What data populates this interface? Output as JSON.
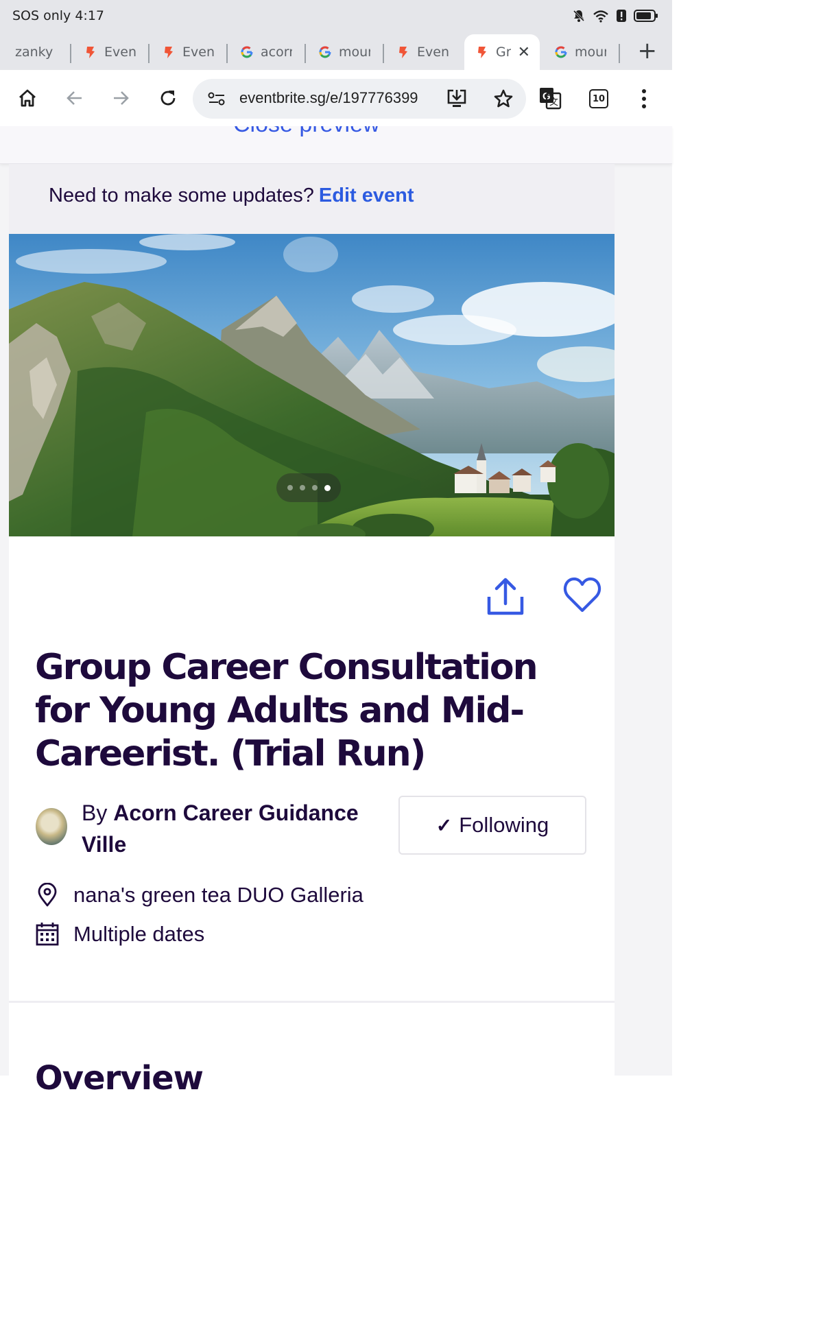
{
  "status_bar": {
    "text": "SOS only 4:17",
    "icons": [
      "bell-off-icon",
      "wifi-icon",
      "alert-icon",
      "battery-icon"
    ]
  },
  "tabs": [
    {
      "label": "zanky",
      "favicon": "generic-icon",
      "active": false
    },
    {
      "label": "Event",
      "favicon": "eventbrite-icon",
      "active": false
    },
    {
      "label": "Event",
      "favicon": "eventbrite-icon",
      "active": false
    },
    {
      "label": "acorn",
      "favicon": "google-icon",
      "active": false
    },
    {
      "label": "moun",
      "favicon": "google-icon",
      "active": false
    },
    {
      "label": "Event",
      "favicon": "eventbrite-icon",
      "active": false
    },
    {
      "label": "Gro",
      "favicon": "eventbrite-icon",
      "active": true
    },
    {
      "label": "moun",
      "favicon": "google-icon",
      "active": false
    }
  ],
  "new_tab_label": "+",
  "toolbar": {
    "url": "eventbrite.sg/e/197776399",
    "tab_count": "10"
  },
  "preview": {
    "close_label": "Close preview"
  },
  "banner": {
    "text": "Need to make some updates?",
    "link": "Edit event"
  },
  "hero": {
    "image": "mountain-village-landscape",
    "slides": 4,
    "active_slide": 4
  },
  "event": {
    "title": "Group Career Consultation for Young Adults and Mid-Careerist. (Trial Run)",
    "by_prefix": "By",
    "organizer": "Acorn Career Guidance Ville",
    "follow_label": "Following",
    "location": "nana's green tea DUO Galleria",
    "dates": "Multiple dates",
    "section_heading": "Overview"
  },
  "colors": {
    "title": "#1e0a3c",
    "link_blue": "#2c5be0",
    "action_blue": "#3659e3",
    "eventbrite_orange": "#f05537"
  }
}
